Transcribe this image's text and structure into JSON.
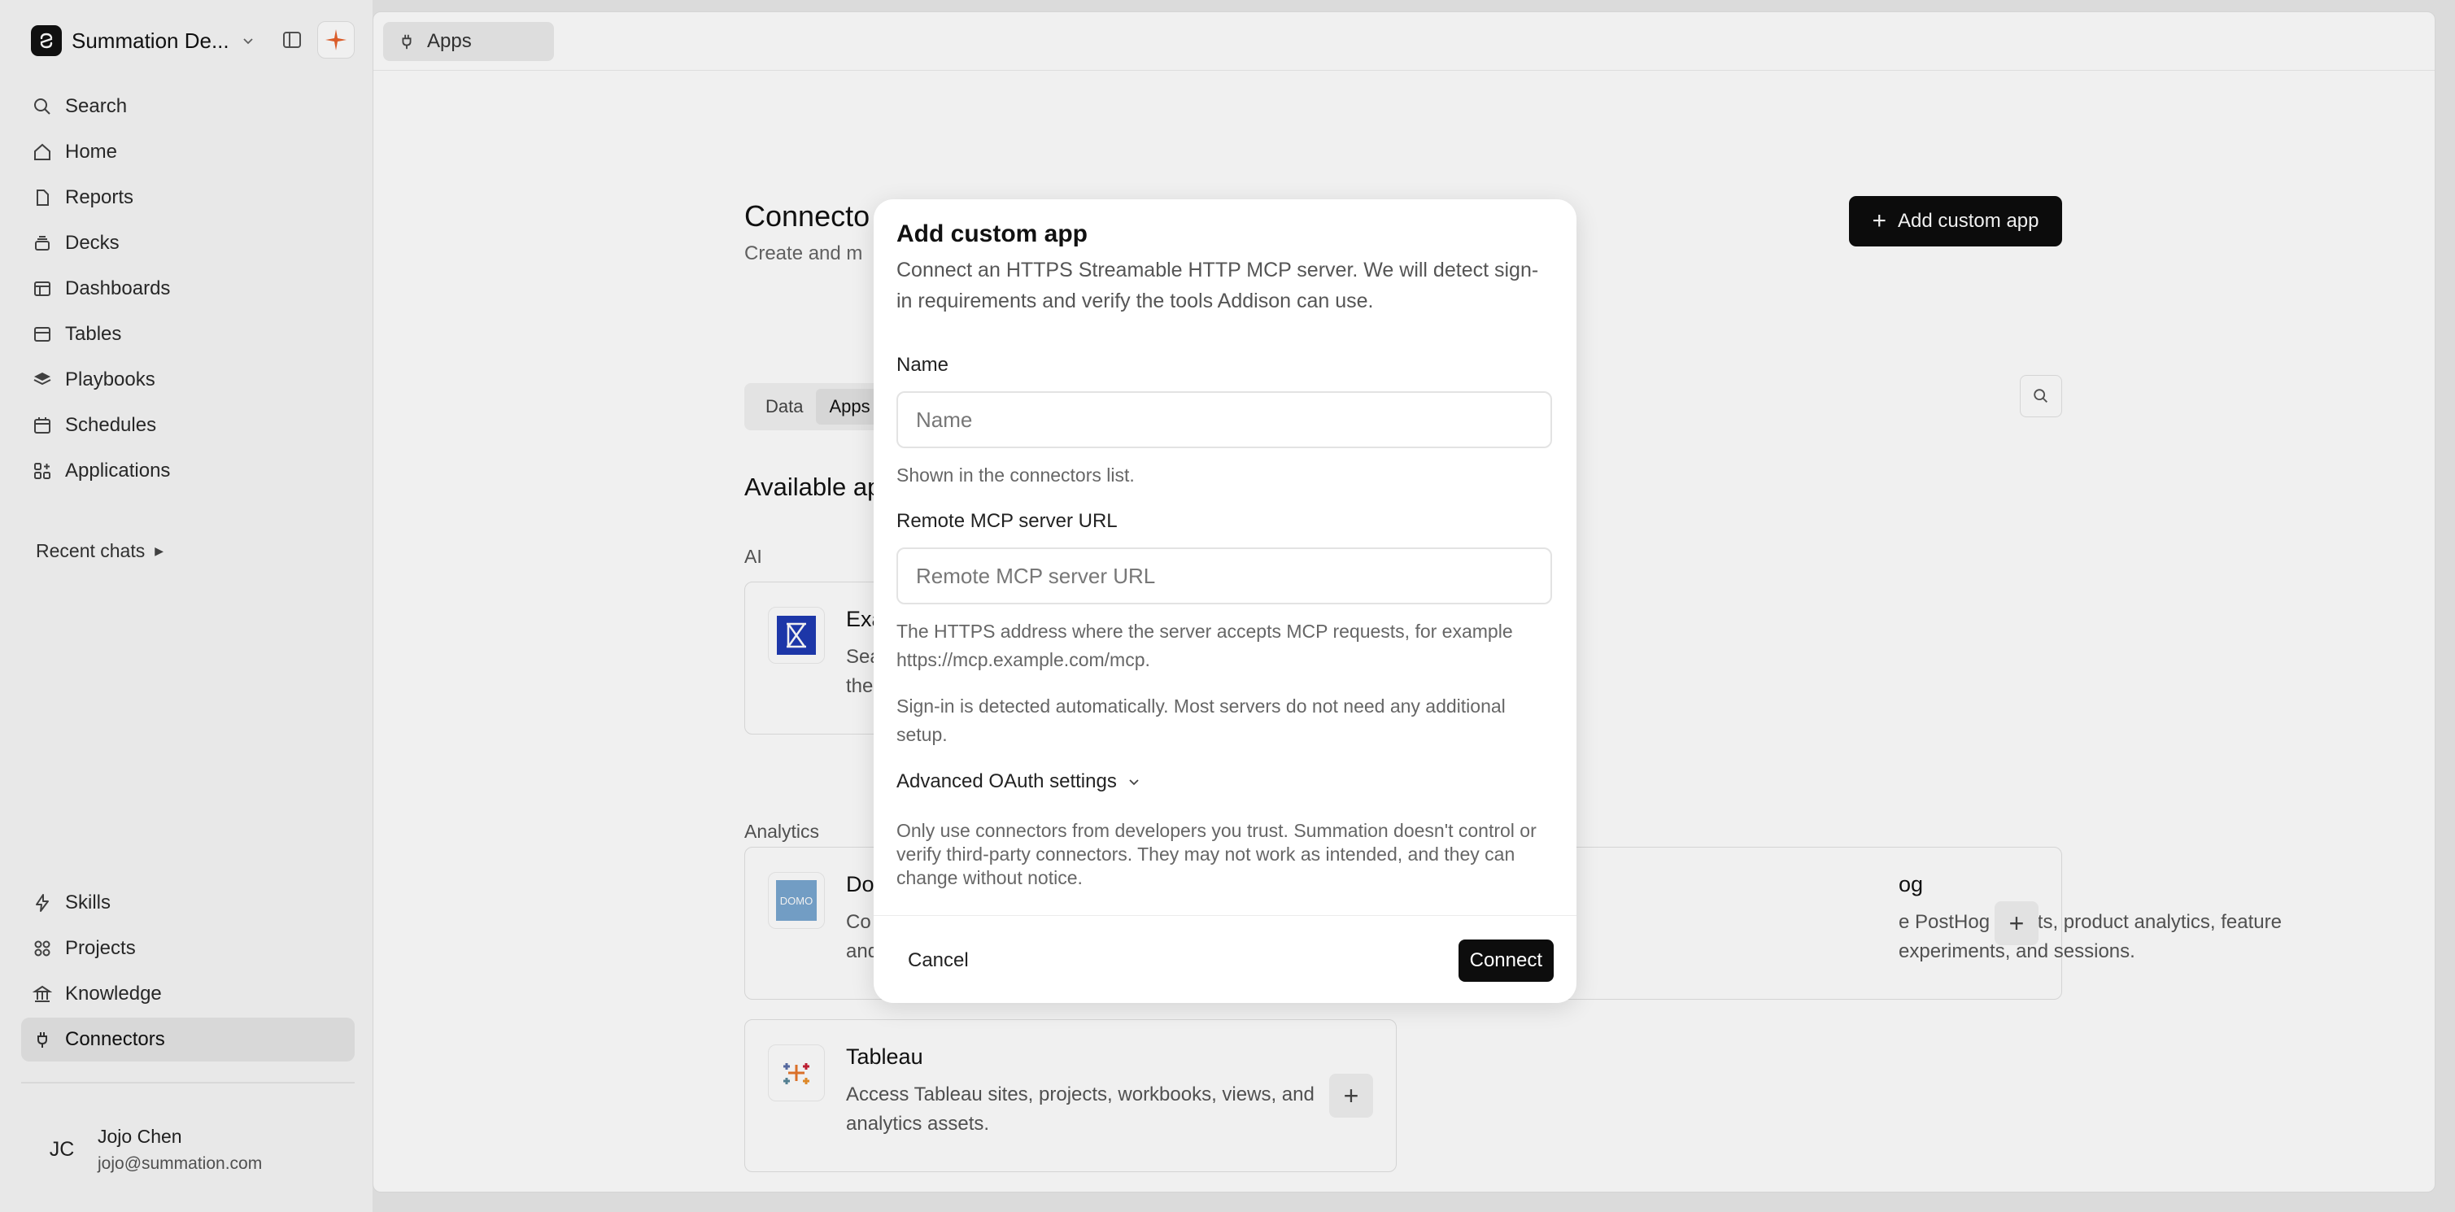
{
  "sidebar": {
    "workspace_name": "Summation De...",
    "nav": [
      {
        "label": "Search",
        "icon": "search-icon"
      },
      {
        "label": "Home",
        "icon": "home-icon"
      },
      {
        "label": "Reports",
        "icon": "report-icon"
      },
      {
        "label": "Decks",
        "icon": "decks-icon"
      },
      {
        "label": "Dashboards",
        "icon": "dashboard-icon"
      },
      {
        "label": "Tables",
        "icon": "table-icon"
      },
      {
        "label": "Playbooks",
        "icon": "playbook-icon"
      },
      {
        "label": "Schedules",
        "icon": "calendar-icon"
      },
      {
        "label": "Applications",
        "icon": "applications-icon"
      }
    ],
    "recent_chats": "Recent chats",
    "bottom_nav": [
      {
        "label": "Skills",
        "icon": "bolt-icon"
      },
      {
        "label": "Projects",
        "icon": "projects-icon"
      },
      {
        "label": "Knowledge",
        "icon": "knowledge-icon"
      },
      {
        "label": "Connectors",
        "icon": "plug-icon",
        "active": true
      }
    ],
    "user": {
      "initials": "JC",
      "name": "Jojo Chen",
      "email": "jojo@summation.com"
    }
  },
  "topbar": {
    "tab_label": "Apps"
  },
  "main": {
    "title": "Connecto",
    "subtitle": "Create and m",
    "add_button": "Add custom app",
    "tabs": [
      {
        "label": "Data"
      },
      {
        "label": "Apps"
      }
    ],
    "section_title": "Available ap",
    "categories": {
      "ai": "AI",
      "analytics": "Analytics"
    },
    "cards": {
      "exa": {
        "title": "Exa",
        "desc_line1": "Sea",
        "desc_line2": "the"
      },
      "domo": {
        "title": "Do",
        "desc_line1": "Co",
        "desc_line2": "and",
        "logo_text": "DOMO"
      },
      "posthog": {
        "title": "og",
        "desc": "e PostHog events, product analytics, feature experiments, and sessions."
      },
      "tableau": {
        "title": "Tableau",
        "desc": "Access Tableau sites, projects, workbooks, views, and analytics assets."
      }
    }
  },
  "modal": {
    "title": "Add custom app",
    "description": "Connect an HTTPS Streamable HTTP MCP server. We will detect sign-in requirements and verify the tools Addison can use.",
    "name_label": "Name",
    "name_placeholder": "Name",
    "name_help": "Shown in the connectors list.",
    "url_label": "Remote MCP server URL",
    "url_placeholder": "Remote MCP server URL",
    "url_help": "The HTTPS address where the server accepts MCP requests, for example https://mcp.example.com/mcp.",
    "signin_help": "Sign-in is detected automatically. Most servers do not need any additional setup.",
    "advanced_label": "Advanced OAuth settings",
    "warning": "Only use connectors from developers you trust. Summation doesn't control or verify third-party connectors. They may not work as intended, and they can change without notice.",
    "cancel_label": "Cancel",
    "connect_label": "Connect"
  }
}
